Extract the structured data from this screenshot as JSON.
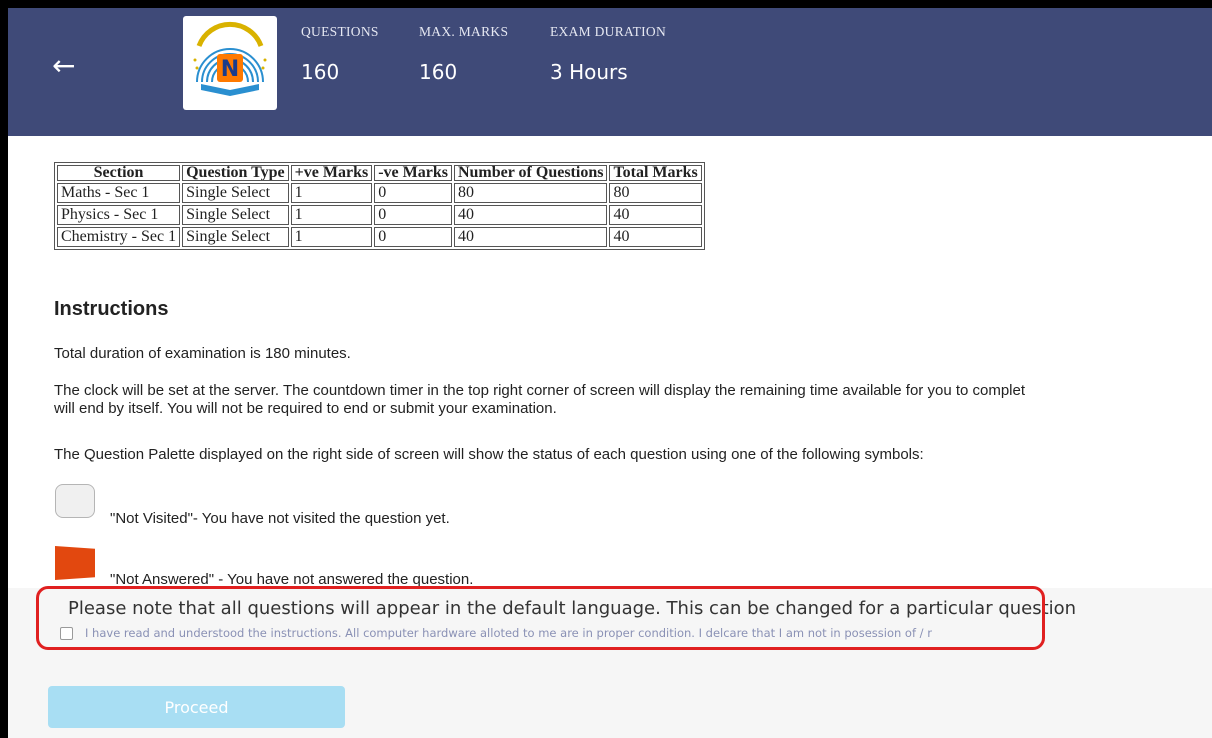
{
  "header": {
    "back_icon": "arrow-left-icon",
    "logo_icon": "navbharat-logo-icon",
    "stats": {
      "questions": {
        "label": "QUESTIONS",
        "value": "160"
      },
      "max_marks": {
        "label": "MAX. MARKS",
        "value": "160"
      },
      "duration": {
        "label": "EXAM DURATION",
        "value": "3 Hours"
      }
    },
    "colors": {
      "background": "#3f4a78"
    }
  },
  "sections_table": {
    "headers": [
      "Section",
      "Question Type",
      "+ve Marks",
      "-ve Marks",
      "Number of Questions",
      "Total Marks"
    ],
    "rows": [
      [
        "Maths - Sec 1",
        "Single Select",
        "1",
        "0",
        "80",
        "80"
      ],
      [
        "Physics - Sec 1",
        "Single Select",
        "1",
        "0",
        "40",
        "40"
      ],
      [
        "Chemistry - Sec 1",
        "Single Select",
        "1",
        "0",
        "40",
        "40"
      ]
    ]
  },
  "instructions": {
    "title": "Instructions",
    "p1": "Total duration of examination is 180 minutes.",
    "p2a": "The clock will be set at the server. The countdown timer in the top right corner of screen will display the remaining time available for you to complet",
    "p2b": "will end by itself. You will not be required to end or submit your examination.",
    "p3": "The Question Palette displayed on the right side of screen will show the status of each question using one of the following symbols:",
    "legend": [
      {
        "icon": "not-visited-icon",
        "text": "\"Not Visited\"- You have not visited the question yet.",
        "color": "#f0f0f0"
      },
      {
        "icon": "not-answered-icon",
        "text": "\"Not Answered\" - You have not answered the question.",
        "color": "#e2480f"
      }
    ]
  },
  "notice": {
    "language_note": "Please note that all questions will appear in the default language. This can be changed for a particular question",
    "agreement": "I have read and understood the instructions. All computer hardware alloted to me are in proper condition. I delcare that I am not in posession of / r",
    "agreement_checked": false,
    "highlight_color": "#e02020",
    "proceed_label": "Proceed",
    "proceed_color": "#a8def3"
  }
}
